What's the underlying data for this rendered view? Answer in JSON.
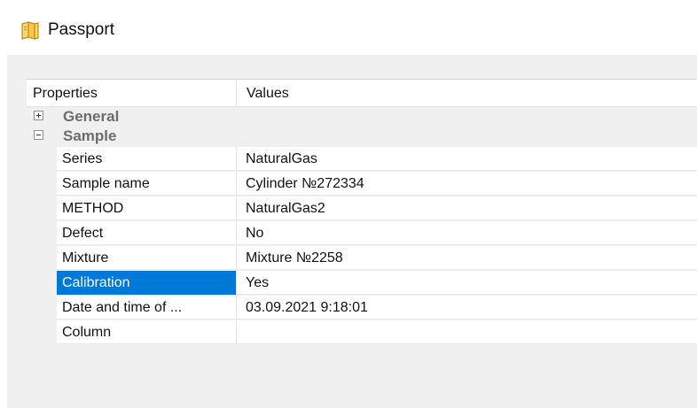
{
  "window": {
    "title": "Passport",
    "icon": "passport-book-icon"
  },
  "grid": {
    "columns": {
      "properties": "Properties",
      "values": "Values"
    },
    "categories": [
      {
        "label": "General",
        "expanded": false,
        "toggle_icon": "expand-plus-icon"
      },
      {
        "label": "Sample",
        "expanded": true,
        "toggle_icon": "collapse-minus-icon"
      }
    ],
    "rows": [
      {
        "name": "Series",
        "value": "NaturalGas",
        "selected": false
      },
      {
        "name": "Sample name",
        "value": "Cylinder №272334",
        "selected": false
      },
      {
        "name": "METHOD",
        "value": "NaturalGas2",
        "selected": false
      },
      {
        "name": "Defect",
        "value": "No",
        "selected": false
      },
      {
        "name": "Mixture",
        "value": "Mixture №2258",
        "selected": false
      },
      {
        "name": "Calibration",
        "value": "Yes",
        "selected": true
      },
      {
        "name": "Date and time of ...",
        "value": "03.09.2021 9:18:01",
        "selected": false
      },
      {
        "name": "Column",
        "value": "",
        "selected": false
      }
    ]
  },
  "colors": {
    "selection": "#0078d7",
    "panel_background": "#f0f0f0",
    "category_text": "#6d6d6d"
  }
}
